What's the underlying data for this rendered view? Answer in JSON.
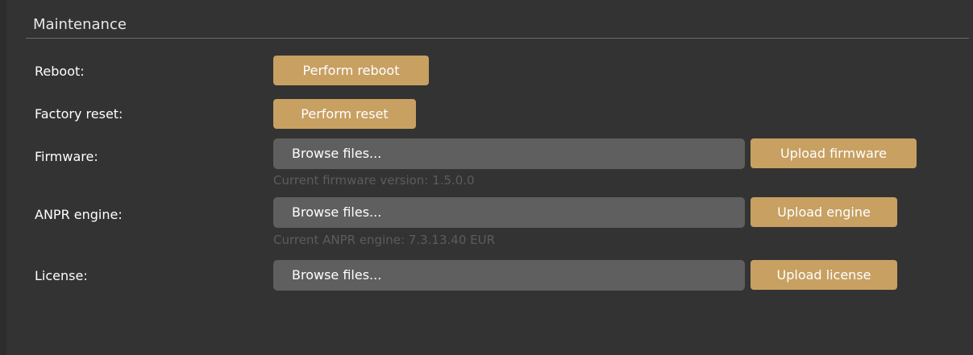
{
  "section": {
    "title": "Maintenance"
  },
  "rows": {
    "reboot": {
      "label": "Reboot:",
      "button": "Perform reboot"
    },
    "factory_reset": {
      "label": "Factory reset:",
      "button": "Perform reset"
    },
    "firmware": {
      "label": "Firmware:",
      "browse": "Browse files...",
      "button": "Upload firmware",
      "hint": "Current firmware version: 1.5.0.0"
    },
    "anpr": {
      "label": "ANPR engine:",
      "browse": "Browse files...",
      "button": "Upload engine",
      "hint": "Current ANPR engine: 7.3.13.40 EUR"
    },
    "license": {
      "label": "License:",
      "browse": "Browse files...",
      "button": "Upload license"
    }
  },
  "colors": {
    "background": "#333333",
    "accent_button": "#c7a062",
    "file_field": "#5f5f5f",
    "hint_text": "#5c5c5c",
    "divider": "#6a6a6a"
  }
}
